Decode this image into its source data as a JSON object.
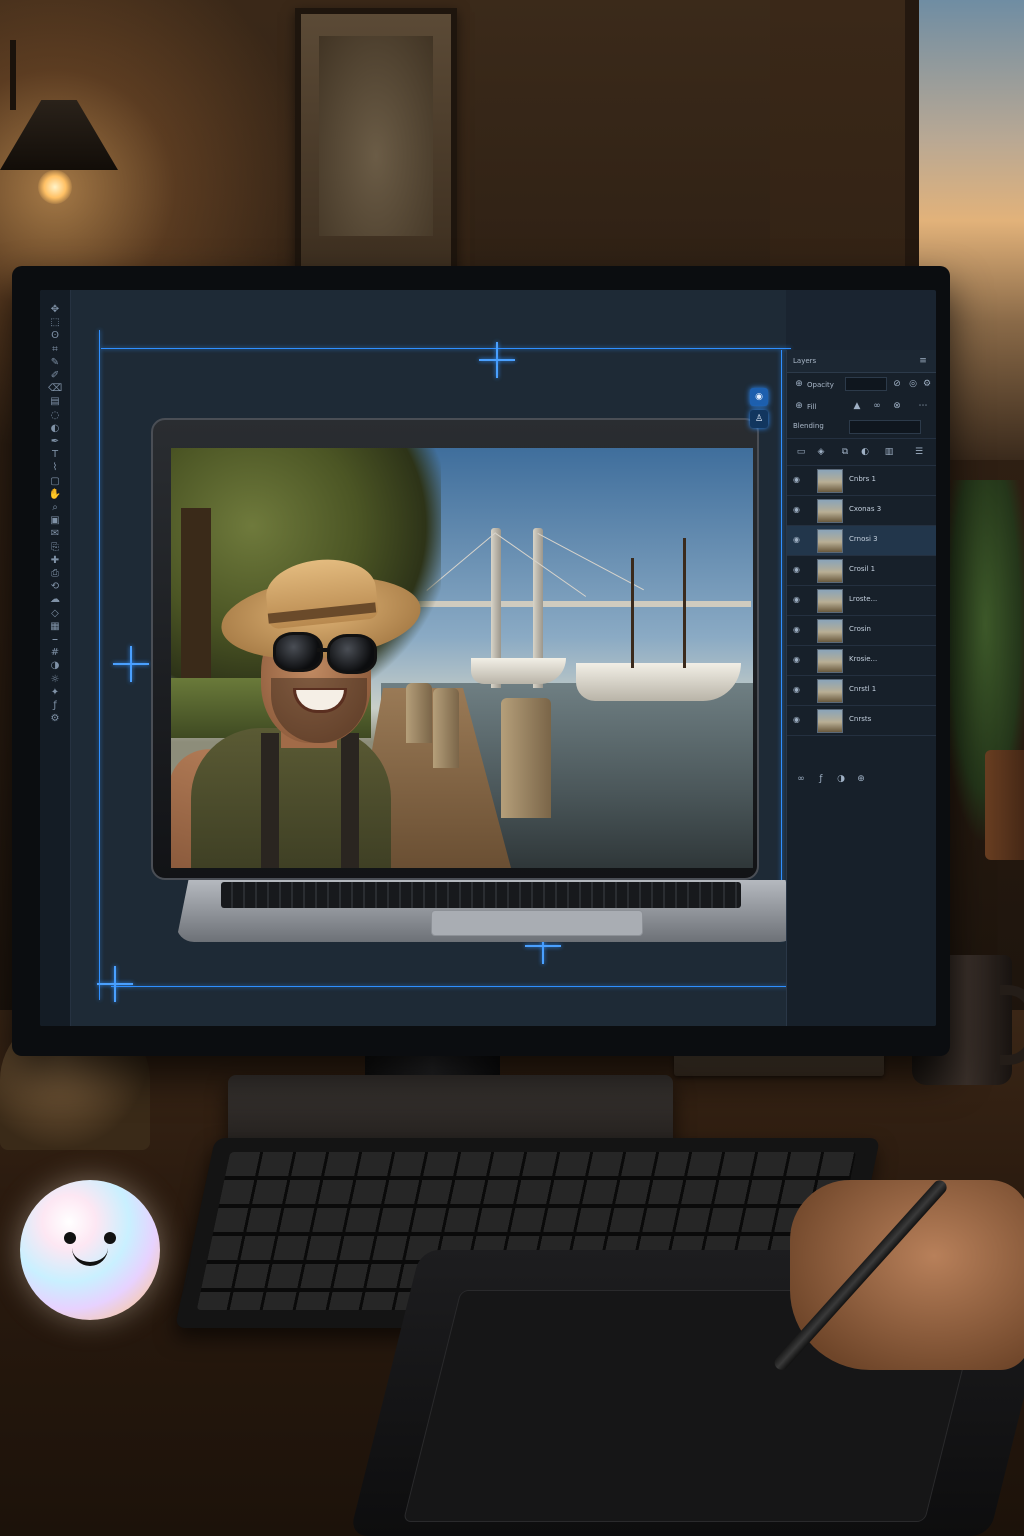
{
  "app": {
    "panel_tab_label": "Layers",
    "panel_row1_label": "Opacity",
    "panel_row2_label": "Fill",
    "panel_row3_label": "Blending"
  },
  "toolbar": {
    "tools": [
      "move-icon",
      "marquee-icon",
      "lasso-icon",
      "crop-icon",
      "eyedropper-icon",
      "brush-icon",
      "eraser-icon",
      "gradient-icon",
      "blur-icon",
      "dodge-icon",
      "pen-icon",
      "text-icon",
      "path-icon",
      "shape-icon",
      "hand-icon",
      "zoom-icon",
      "frame-icon",
      "note-icon",
      "clone-icon",
      "heal-icon",
      "stamp-icon",
      "history-icon",
      "smudge-icon",
      "slice-icon",
      "artboard-icon",
      "ruler-icon",
      "grid-icon",
      "mask-icon",
      "adjust-icon",
      "effects-icon",
      "fx-icon",
      "settings-icon"
    ]
  },
  "layers": [
    {
      "name": "Cnbrs 1",
      "selected": false
    },
    {
      "name": "Cxonas 3",
      "selected": false
    },
    {
      "name": "Crnosi 3",
      "selected": true
    },
    {
      "name": "Crosil 1",
      "selected": false
    },
    {
      "name": "Lroste...",
      "selected": false
    },
    {
      "name": "Crosin",
      "selected": false
    },
    {
      "name": "Krosie...",
      "selected": false
    },
    {
      "name": "Cnrstl 1",
      "selected": false
    },
    {
      "name": "Cnrsts",
      "selected": false
    }
  ],
  "colors": {
    "accent_guide": "#2f8fff",
    "panel_bg": "#17202a",
    "canvas_bg": "#1e2a36"
  },
  "icons": {
    "visibility": "eye-icon",
    "side_tool_1": "adjust-icon",
    "side_tool_2": "person-icon",
    "mascot": "smiley-orb-icon"
  }
}
